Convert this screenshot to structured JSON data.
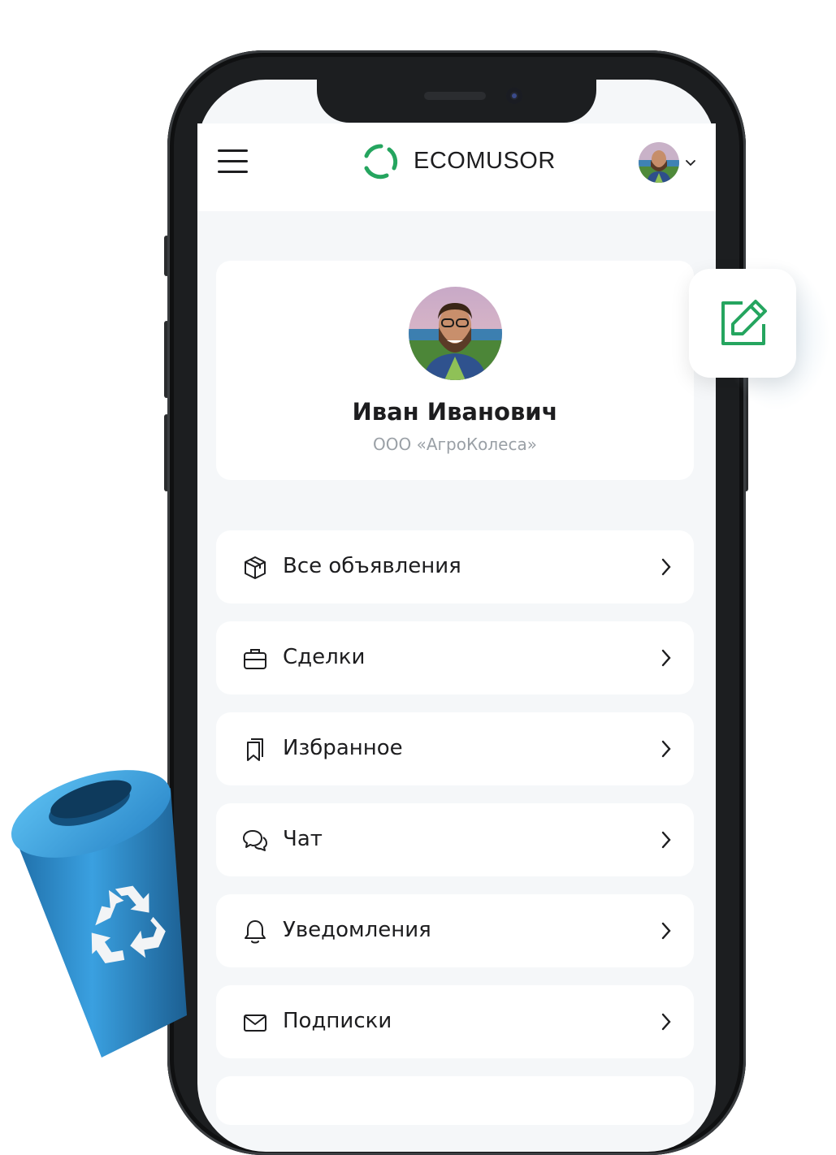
{
  "header": {
    "logo_text": "ECOMUSOR"
  },
  "profile": {
    "name": "Иван Иванович",
    "company": "ООО «АгроКолеса»"
  },
  "menu": [
    {
      "label": "Все объявления",
      "icon": "box-icon"
    },
    {
      "label": "Сделки",
      "icon": "briefcase-icon"
    },
    {
      "label": "Избранное",
      "icon": "bookmarks-icon"
    },
    {
      "label": "Чат",
      "icon": "chat-icon"
    },
    {
      "label": "Уведомления",
      "icon": "bell-icon"
    },
    {
      "label": "Подписки",
      "icon": "mail-icon"
    }
  ],
  "colors": {
    "brand_green": "#25a55f",
    "text": "#1d1d1f",
    "muted": "#9aa0a6",
    "background": "#f5f7f9",
    "bin_blue": "#2f8fd0"
  }
}
